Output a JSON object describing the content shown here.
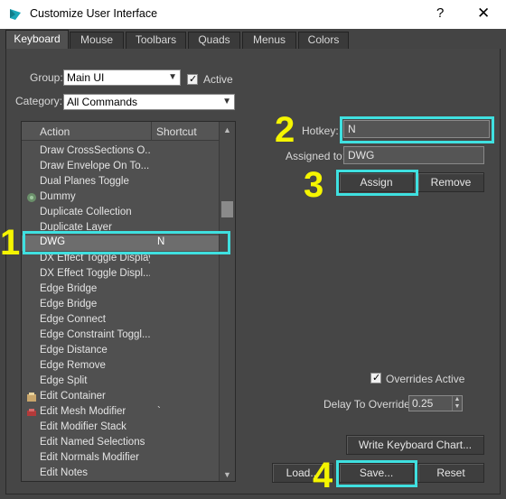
{
  "window": {
    "title": "Customize User Interface",
    "help": "?",
    "close": "✕"
  },
  "tabs": [
    {
      "label": "Keyboard",
      "active": true
    },
    {
      "label": "Mouse"
    },
    {
      "label": "Toolbars"
    },
    {
      "label": "Quads"
    },
    {
      "label": "Menus"
    },
    {
      "label": "Colors"
    }
  ],
  "group": {
    "label": "Group:",
    "value": "Main UI"
  },
  "active": {
    "label": "Active",
    "checked": true
  },
  "category": {
    "label": "Category:",
    "value": "All Commands"
  },
  "list": {
    "columns": {
      "action": "Action",
      "shortcut": "Shortcut"
    },
    "rows": [
      {
        "action": "Draw CrossSections O...",
        "shortcut": ""
      },
      {
        "action": "Draw Envelope On To...",
        "shortcut": ""
      },
      {
        "action": "Dual Planes Toggle",
        "shortcut": ""
      },
      {
        "action": "Dummy",
        "shortcut": "",
        "icon": "dummy-icon"
      },
      {
        "action": "Duplicate Collection",
        "shortcut": ""
      },
      {
        "action": "Duplicate Layer",
        "shortcut": ""
      },
      {
        "action": "DWG",
        "shortcut": "N",
        "selected": true
      },
      {
        "action": "DX Effect Toggle Display",
        "shortcut": ""
      },
      {
        "action": "DX Effect Toggle Displ...",
        "shortcut": ""
      },
      {
        "action": "Edge Bridge",
        "shortcut": ""
      },
      {
        "action": "Edge Bridge",
        "shortcut": ""
      },
      {
        "action": "Edge Connect",
        "shortcut": ""
      },
      {
        "action": "Edge Constraint Toggl...",
        "shortcut": ""
      },
      {
        "action": "Edge Distance",
        "shortcut": ""
      },
      {
        "action": "Edge Remove",
        "shortcut": ""
      },
      {
        "action": "Edge Split",
        "shortcut": ""
      },
      {
        "action": "Edit Container",
        "shortcut": "",
        "icon": "container-icon"
      },
      {
        "action": "Edit Mesh Modifier",
        "shortcut": "`",
        "icon": "mesh-modifier-icon"
      },
      {
        "action": "Edit Modifier Stack",
        "shortcut": ""
      },
      {
        "action": "Edit Named Selections",
        "shortcut": ""
      },
      {
        "action": "Edit Normals Modifier",
        "shortcut": ""
      },
      {
        "action": "Edit Notes",
        "shortcut": ""
      }
    ]
  },
  "hotkey": {
    "label": "Hotkey:",
    "value": "N"
  },
  "assigned": {
    "label": "Assigned to:",
    "value": "DWG"
  },
  "buttons": {
    "assign": "Assign",
    "remove": "Remove",
    "write_chart": "Write Keyboard Chart...",
    "load": "Load...",
    "save": "Save...",
    "reset": "Reset"
  },
  "overrides": {
    "label": "Overrides Active",
    "checked": true
  },
  "delay": {
    "label": "Delay To Override:",
    "value": "0.25"
  },
  "annotations": [
    "1",
    "2",
    "3",
    "4"
  ],
  "colors": {
    "highlight": "#3fe0e0",
    "step_number": "#f5f500",
    "app_icon": "#1aa6b7"
  }
}
